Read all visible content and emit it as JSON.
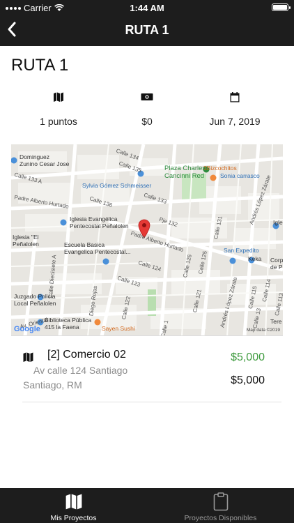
{
  "status_bar": {
    "carrier": "Carrier",
    "time": "1:44 AM"
  },
  "nav": {
    "title": "RUTA 1",
    "back_icon": "chevron-left-icon"
  },
  "page": {
    "heading": "RUTA 1"
  },
  "stats": [
    {
      "icon": "map-icon",
      "value": "1 puntos"
    },
    {
      "icon": "money-icon",
      "value": "$0"
    },
    {
      "icon": "calendar-icon",
      "value": "Jun 7, 2019"
    }
  ],
  "map": {
    "street_labels": [
      "Calle 134",
      "Calle 135",
      "Calle 133 A",
      "Calle 136",
      "Padre Alberto Hurtado",
      "Calle 133",
      "Pje 132",
      "Padre Alberto Hurtado",
      "Calle 131",
      "Calle 126",
      "Calle 125",
      "Calle 124",
      "Calle 123",
      "Calle 122",
      "Calle 121",
      "Calle 115",
      "Calle 114",
      "Calle 113",
      "Diego Rojas",
      "Calle Diecisiete A",
      "Av. Oriental",
      "Calle 1",
      "Andrés López Zárate",
      "Andrés López Zárate",
      "Calle 13"
    ],
    "places": {
      "dominguez": "Dominguez\nZunino Cesar Jose",
      "sylvia": "Sylvia Gómez Schmeisser",
      "plaza": "Plaza Charles\nCancinni Red",
      "bizcochitos": "3Bizcochitos",
      "sonia": "Sonia carrasco",
      "iglesia_pente": "Iglesia Evangélica\nPentecostal Peñalolen",
      "iglesia_el": "Iglesia \"El\nPeñalolen",
      "escuela": "Escuela Basica\nEvangelica Pentecostal...",
      "san_expedito": "San Expedito",
      "keka": "Keka",
      "iglesia_right": "Igle",
      "corp": "Corp\nde P",
      "juzgado": "Juzgado Policia\nLocal Peñalolen",
      "biblioteca": "Biblioteca Pública\n415 la Faena",
      "sayen": "Sayen Sushi",
      "tere": "Tere"
    },
    "google": "Google",
    "map_data": "Map data ©2019"
  },
  "items": [
    {
      "icon": "map-icon",
      "name": "[2] Comercio 02",
      "address": "Av calle 124 Santiago",
      "city": "Santiago, RM",
      "price_top": "$5,000",
      "price_bottom": "$5,000"
    }
  ],
  "tabs": [
    {
      "label": "Mis Proyectos",
      "icon": "map-icon",
      "active": true
    },
    {
      "label": "Proyectos Disponibles",
      "icon": "clipboard-icon",
      "active": false
    }
  ],
  "colors": {
    "bar": "#1d1d1d",
    "price_green": "#3f9b3f",
    "pin_red": "#e53935"
  }
}
